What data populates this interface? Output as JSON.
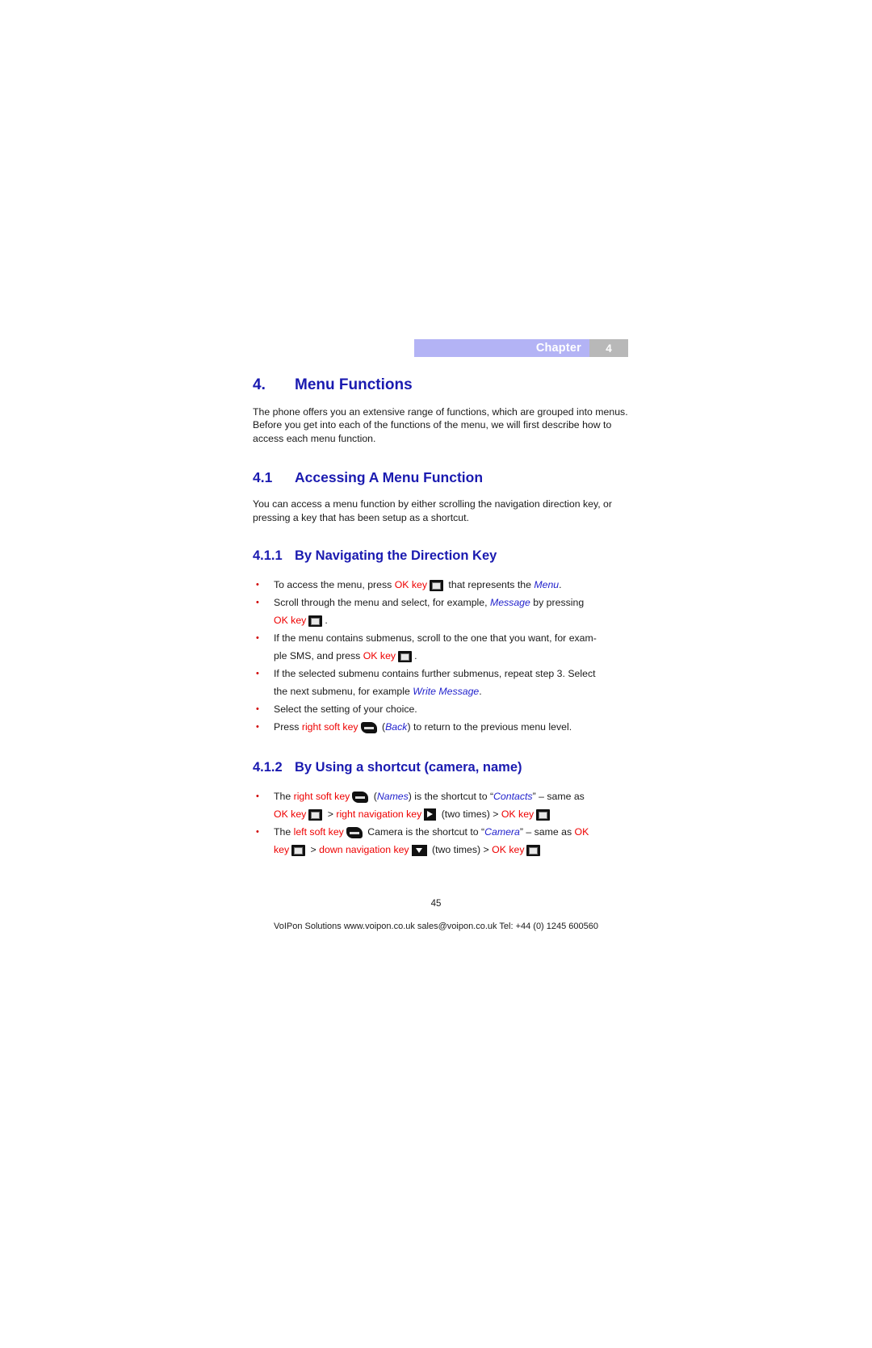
{
  "chapter_banner": {
    "label": "Chapter",
    "number": "4",
    "label_bg": "#b3b3f5",
    "number_bg": "#b8b8b8"
  },
  "headings": {
    "h4": {
      "num": "4.",
      "text": "Menu Functions"
    },
    "h41": {
      "num": "4.1",
      "text": "Accessing A Menu Function"
    },
    "h411": {
      "num": "4.1.1",
      "text": "By Navigating the Direction Key"
    },
    "h412": {
      "num": "4.1.2",
      "text": "By Using a shortcut (camera, name)"
    }
  },
  "paragraphs": {
    "intro": "The phone offers you an extensive range of functions, which are grouped into menus. Before you get into each of the functions of the menu, we will first describe how to access each menu function.",
    "accessing": "You can access a menu function by either scrolling the navigation direction key, or pressing a key that has been setup as a shortcut."
  },
  "bullets_411": [
    {
      "parts": [
        {
          "t": "text",
          "v": "To access the menu, press "
        },
        {
          "t": "red",
          "v": "OK key"
        },
        {
          "t": "icon",
          "v": "ok-key"
        },
        {
          "t": "text",
          "v": " that represents the "
        },
        {
          "t": "blueit",
          "v": "Menu"
        },
        {
          "t": "text",
          "v": "."
        }
      ]
    },
    {
      "parts": [
        {
          "t": "text",
          "v": "Scroll through the menu and select, for example, "
        },
        {
          "t": "blueit",
          "v": "Message"
        },
        {
          "t": "text",
          "v": " by pressing "
        },
        {
          "t": "break",
          "v": ""
        },
        {
          "t": "red",
          "v": "OK key"
        },
        {
          "t": "icon",
          "v": "ok-key"
        },
        {
          "t": "text",
          "v": "."
        }
      ]
    },
    {
      "parts": [
        {
          "t": "text",
          "v": " If the menu contains submenus, scroll to the one that you want, for exam-"
        },
        {
          "t": "break",
          "v": ""
        },
        {
          "t": "text",
          "v": "ple SMS, and press "
        },
        {
          "t": "red",
          "v": "OK key"
        },
        {
          "t": "icon",
          "v": "ok-key"
        },
        {
          "t": "text",
          "v": "."
        }
      ]
    },
    {
      "parts": [
        {
          "t": "text",
          "v": "If the selected submenu contains further submenus, repeat step 3. Select "
        },
        {
          "t": "break",
          "v": ""
        },
        {
          "t": "text",
          "v": "the next submenu, for example "
        },
        {
          "t": "blueit",
          "v": "Write Message"
        },
        {
          "t": "text",
          "v": "."
        }
      ]
    },
    {
      "parts": [
        {
          "t": "text",
          "v": "Select the setting of your choice."
        }
      ]
    },
    {
      "parts": [
        {
          "t": "text",
          "v": "Press "
        },
        {
          "t": "red",
          "v": "right soft key"
        },
        {
          "t": "icon",
          "v": "soft-key"
        },
        {
          "t": "text",
          "v": " ("
        },
        {
          "t": "blueit",
          "v": "Back"
        },
        {
          "t": "text",
          "v": ") to return to the previous menu level."
        }
      ]
    }
  ],
  "bullets_412": [
    {
      "parts": [
        {
          "t": "text",
          "v": "The "
        },
        {
          "t": "red",
          "v": "right soft key"
        },
        {
          "t": "icon",
          "v": "soft-key"
        },
        {
          "t": "text",
          "v": " ("
        },
        {
          "t": "blueit",
          "v": "Names"
        },
        {
          "t": "text",
          "v": ") is the shortcut to “"
        },
        {
          "t": "blueit",
          "v": "Contacts"
        },
        {
          "t": "text",
          "v": "” – same as "
        },
        {
          "t": "break",
          "v": ""
        },
        {
          "t": "red",
          "v": "OK key"
        },
        {
          "t": "icon",
          "v": "ok-key"
        },
        {
          "t": "text",
          "v": " > "
        },
        {
          "t": "red",
          "v": "right navigation key"
        },
        {
          "t": "icon",
          "v": "nav-right"
        },
        {
          "t": "text",
          "v": " (two times) > "
        },
        {
          "t": "red",
          "v": "OK key"
        },
        {
          "t": "icon",
          "v": "ok-key"
        }
      ]
    },
    {
      "parts": [
        {
          "t": "text",
          "v": "The "
        },
        {
          "t": "red",
          "v": "left soft key"
        },
        {
          "t": "icon",
          "v": "soft-key"
        },
        {
          "t": "text",
          "v": " Camera is the shortcut to “"
        },
        {
          "t": "blueit",
          "v": "Camera"
        },
        {
          "t": "text",
          "v": "” – same as "
        },
        {
          "t": "red",
          "v": "OK"
        },
        {
          "t": "break",
          "v": ""
        },
        {
          "t": "red",
          "v": "key"
        },
        {
          "t": "icon",
          "v": "ok-key"
        },
        {
          "t": "text",
          "v": " > "
        },
        {
          "t": "red",
          "v": "down navigation key"
        },
        {
          "t": "icon",
          "v": "nav-down"
        },
        {
          "t": "text",
          "v": " (two times) > "
        },
        {
          "t": "red",
          "v": "OK key"
        },
        {
          "t": "icon",
          "v": "ok-key"
        }
      ]
    }
  ],
  "footer": {
    "page_number": "45",
    "credit": "VoIPon Solutions  www.voipon.co.uk  sales@voipon.co.uk  Tel: +44 (0) 1245 600560"
  }
}
